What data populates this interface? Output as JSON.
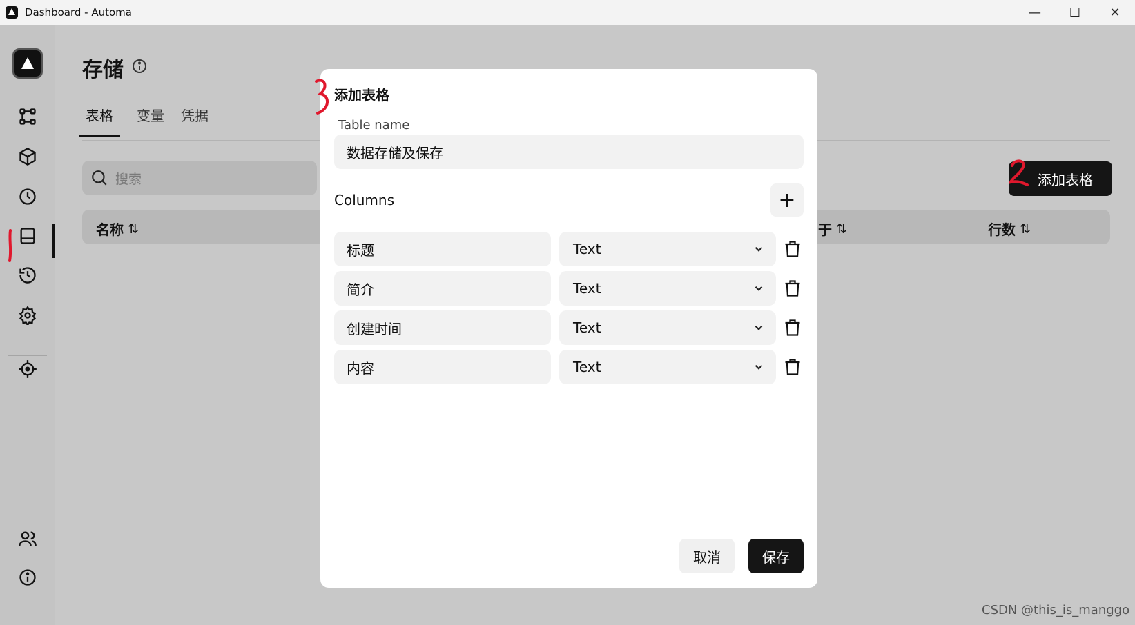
{
  "window": {
    "title": "Dashboard - Automa",
    "controls": {
      "minimize": "—",
      "maximize": "☐",
      "close": "✕"
    }
  },
  "page": {
    "title": "存储",
    "tabs": [
      {
        "label": "表格",
        "active": true
      },
      {
        "label": "变量",
        "active": false
      },
      {
        "label": "凭据",
        "active": false
      }
    ],
    "search": {
      "placeholder": "搜索"
    },
    "add_table_label": "添加表格",
    "table_headers": [
      "名称",
      "于",
      "行数"
    ],
    "sort_glyph": "⇅"
  },
  "modal": {
    "title": "添加表格",
    "table_name_label": "Table name",
    "table_name_value": "数据存储及保存",
    "columns_label": "Columns",
    "add_column_glyph": "+",
    "columns": [
      {
        "name": "标题",
        "type": "Text"
      },
      {
        "name": "简介",
        "type": "Text"
      },
      {
        "name": "创建时间",
        "type": "Text"
      },
      {
        "name": "内容",
        "type": "Text"
      }
    ],
    "cancel_label": "取消",
    "save_label": "保存"
  },
  "watermark": "CSDN @this_is_manggo",
  "colors": {
    "annotation": "#e0182d",
    "dark_button": "#151515",
    "backdrop": "#c8c8c8"
  }
}
